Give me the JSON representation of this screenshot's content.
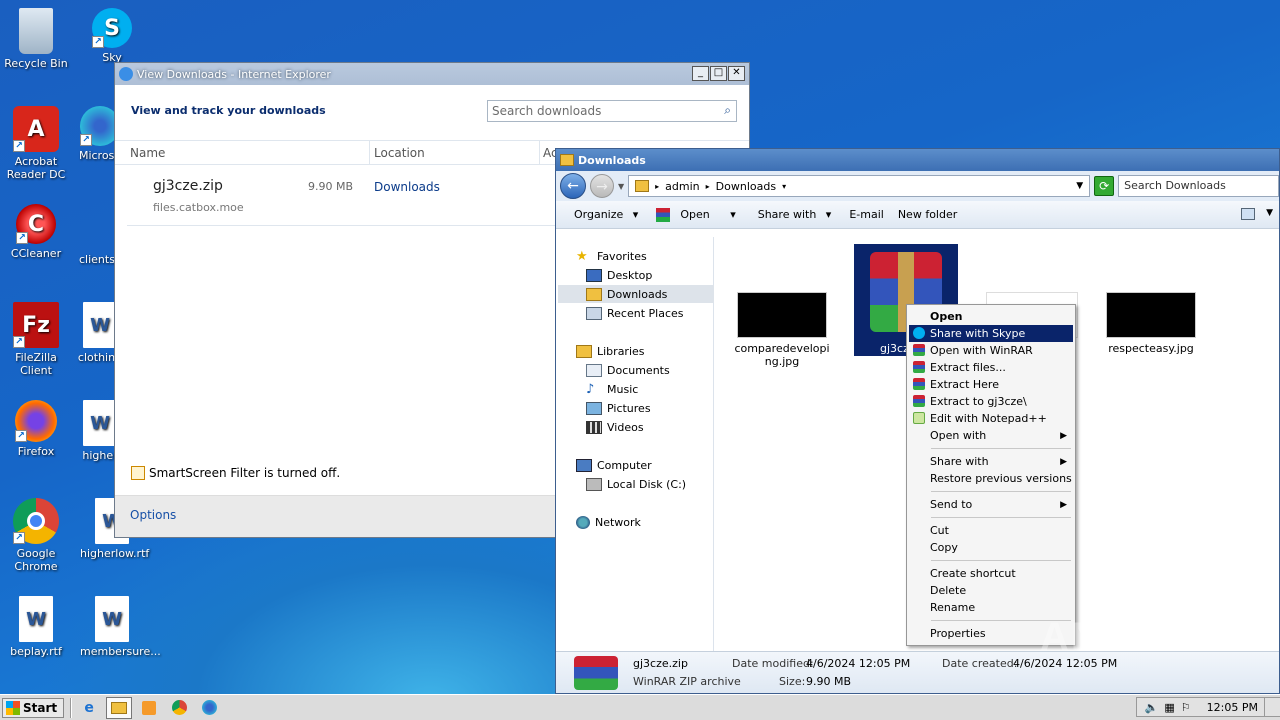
{
  "desktop": {
    "icons": [
      {
        "label": "Recycle Bin",
        "color": "#9ab"
      },
      {
        "label": "Sky",
        "color": "#00aff0"
      },
      {
        "label": "Acrobat Reader DC",
        "color": "#d8261b"
      },
      {
        "label": "Microso",
        "color": "#1b8fd8"
      },
      {
        "label": "CCleaner",
        "color": "#e23"
      },
      {
        "label": "clientsc",
        "color": "#2a7de1"
      },
      {
        "label": "FileZilla Client",
        "color": "#b11"
      },
      {
        "label": "clothing",
        "color": "#2b5797"
      },
      {
        "label": "Firefox",
        "color": "#ff6a00"
      },
      {
        "label": "higher",
        "color": "#2b5797"
      },
      {
        "label": "Google Chrome",
        "color": "#2a9a4a"
      },
      {
        "label": "higherlow.rtf",
        "color": "#2b5797"
      },
      {
        "label": "beplay.rtf",
        "color": "#2b5797"
      },
      {
        "label": "membersure...",
        "color": "#2b5797"
      }
    ]
  },
  "ie": {
    "title": "View Downloads - Internet Explorer",
    "heading": "View and track your downloads",
    "search_placeholder": "Search downloads",
    "columns": [
      "Name",
      "Location",
      "Ac"
    ],
    "download": {
      "name": "gj3cze.zip",
      "size": "9.90 MB",
      "location": "Downloads",
      "source": "files.catbox.moe"
    },
    "smartscreen": "SmartScreen Filter is turned off.",
    "options": "Options"
  },
  "explorer": {
    "title": "Downloads",
    "breadcrumb": [
      "admin",
      "Downloads"
    ],
    "search_placeholder": "Search Downloads",
    "toolbar": {
      "organize": "Organize",
      "open": "Open",
      "share": "Share with",
      "email": "E-mail",
      "new_folder": "New folder"
    },
    "nav": {
      "favorites": "Favorites",
      "desktop": "Desktop",
      "downloads": "Downloads",
      "recent": "Recent Places",
      "libraries": "Libraries",
      "documents": "Documents",
      "music": "Music",
      "pictures": "Pictures",
      "videos": "Videos",
      "computer": "Computer",
      "local_disk": "Local Disk (C:)",
      "network": "Network"
    },
    "files": [
      {
        "name": "comparedeveloping.jpg"
      },
      {
        "name": "gj3cze"
      },
      {
        "name": "respecteasy.jpg"
      }
    ],
    "details": {
      "name": "gj3cze.zip",
      "type": "WinRAR ZIP archive",
      "modified_label": "Date modified:",
      "modified": "4/6/2024 12:05 PM",
      "size_label": "Size:",
      "size": "9.90 MB",
      "created_label": "Date created:",
      "created": "4/6/2024 12:05 PM"
    }
  },
  "context_menu": {
    "items": [
      "Open",
      "Share with Skype",
      "Open with WinRAR",
      "Extract files...",
      "Extract Here",
      "Extract to gj3cze\\",
      "Edit with Notepad++",
      "Open with",
      "Share with",
      "Restore previous versions",
      "Send to",
      "Cut",
      "Copy",
      "Create shortcut",
      "Delete",
      "Rename",
      "Properties"
    ]
  },
  "taskbar": {
    "start": "Start",
    "time": "12:05 PM"
  },
  "watermark": "ANY RUN"
}
